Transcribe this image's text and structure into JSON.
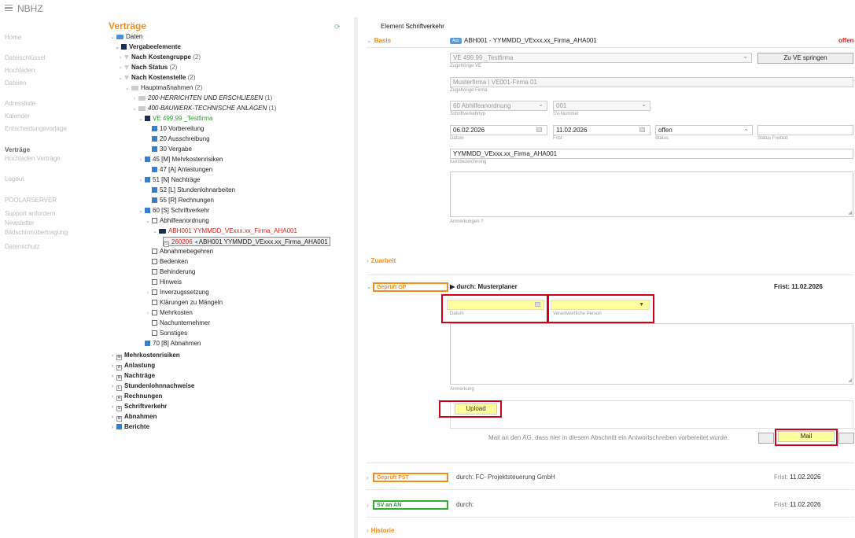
{
  "app": {
    "title": "NBHZ"
  },
  "nav": {
    "items": [
      {
        "label": "Home"
      },
      {
        "label": "Dateischlüssel"
      },
      {
        "label": "Hochladen"
      },
      {
        "label": "Dateien"
      },
      {
        "label": "Adressliste"
      },
      {
        "label": "Kalender"
      },
      {
        "label": "Entscheidungsvorlage"
      },
      {
        "label": "Verträge"
      },
      {
        "label": "Hochladen Verträge"
      },
      {
        "label": "Logout"
      },
      {
        "label": "POOLARSERVER"
      },
      {
        "label": "Support anfordern"
      },
      {
        "label": "Newsletter"
      },
      {
        "label": "Bildschirmübertragung"
      },
      {
        "label": "Datenschutz"
      }
    ]
  },
  "tree": {
    "title": "Verträge",
    "rows": [
      {
        "label": "Daten"
      },
      {
        "label": "Vergabeelemente"
      },
      {
        "label": "Nach Kostengruppe",
        "count": "(2)"
      },
      {
        "label": "Nach Status",
        "count": "(2)"
      },
      {
        "label": "Nach Kostenstelle",
        "count": "(2)"
      },
      {
        "label": "Hauptmaßnahmen",
        "count": "(2)"
      },
      {
        "label": "200-HERRICHTEN UND ERSCHLIEßEN",
        "count": "(1)"
      },
      {
        "label": "400-BAUWERK-TECHNISCHE ANLAGEN",
        "count": "(1)"
      },
      {
        "label": "VE 499.99 _Testfirma"
      },
      {
        "label": "10 Vorbereitung"
      },
      {
        "label": "20 Ausschreibung"
      },
      {
        "label": "30 Vergabe"
      },
      {
        "label": "45 [M] Mehrkostenrisiken"
      },
      {
        "label": "47 [A] Anlastungen"
      },
      {
        "label": "51 [N] Nachträge"
      },
      {
        "label": "52 [L] Stundenlohnarbeiten"
      },
      {
        "label": "55 [R] Rechnungen"
      },
      {
        "label": "60 [S] Schriftverkehr"
      },
      {
        "label": "Abhilfeanordnung"
      },
      {
        "label": "ABH001 YYMMDD_VExxx.xx_Firma_AHA001"
      },
      {
        "label_red": "260206",
        "label": "ABH001 YYMMDD_VExxx.xx_Firma_AHA001"
      },
      {
        "label": "Abnahmebegehren"
      },
      {
        "label": "Bedenken"
      },
      {
        "label": "Behinderung"
      },
      {
        "label": "Hinweis"
      },
      {
        "label": "Inverzugssetzung"
      },
      {
        "label": "Klärungen zu Mängeln"
      },
      {
        "label": "Mehrkosten"
      },
      {
        "label": "Nachunternehmer"
      },
      {
        "label": "Sonstiges"
      },
      {
        "label": "70 [B] Abnahmen"
      },
      {
        "label": "Mehrkostenrisiken"
      },
      {
        "label": "Anlastung"
      },
      {
        "label": "Nachträge"
      },
      {
        "label": "Stundenlohnnachweise"
      },
      {
        "label": "Rechnungen"
      },
      {
        "label": "Schriftverkehr"
      },
      {
        "label": "Abnahmen"
      },
      {
        "label": "Berichte"
      }
    ]
  },
  "detail": {
    "element_prefix": "Element",
    "element_name": "Schriftverkehr",
    "basis": {
      "heading": "Basis",
      "badge": "Aus",
      "doc_title": "ABH001 - YYMMDD_VExxx.xx_Firma_AHA001",
      "status_right": "offen",
      "ve_value": "VE 499.99 _Testfirma",
      "ve_label": "Zugehörige VE",
      "jump_button": "Zu VE springen",
      "firm_value": "Musterfirma | VE001-Firma 01",
      "firm_label": "Zugehörige Firma",
      "type_value": "60 Abhilfeanordnung",
      "type_label": "Schriftverkehrtyp",
      "sv_value": "001",
      "sv_label": "SV-Nummer",
      "date_value": "06.02.2026",
      "date_label": "Datum",
      "deadline_value": "11.02.2026",
      "deadline_label": "Frist",
      "status_value": "offen",
      "status_label": "Status",
      "status_free_label": "Status Freitext",
      "short_value": "YYMMDD_VExxx.xx_Firma_AHA001",
      "short_label": "Kurzbezeichnung",
      "notes_label": "Anmerkungen ?"
    },
    "zuarbeit": {
      "heading": "Zuarbeit"
    },
    "geprueft_gp": {
      "tag": "Geprüft GP",
      "by": "▶ durch: Musterplaner",
      "deadline": "Frist: 11.02.2026",
      "date_label": "Datum",
      "person_label": "Verantwortliche Person",
      "note_label": "Anmerkung",
      "upload_button": "Upload",
      "mail_text": "Mail an den AG, dass hier in diesem Abschnitt ein Antwortschreiben vorbereitet wurde.",
      "mail_button": "Mail"
    },
    "geprueft_pst": {
      "tag": "Geprüft PST",
      "by": "durch: FC- Projektsteuerung GmbH",
      "deadline_prefix": "Frist:",
      "deadline": "11.02.2026"
    },
    "sv_an_an": {
      "tag": "SV an AN",
      "by": "durch:",
      "deadline_prefix": "Frist:",
      "deadline": "11.02.2026"
    },
    "historie": {
      "heading": "Historie"
    }
  },
  "colors": {
    "accent": "#f28c1e",
    "highlight_red": "#d0021b",
    "tree_blue": "#3a7dc9",
    "yellow_field": "#ffff9e",
    "green": "#2a9a2a"
  }
}
